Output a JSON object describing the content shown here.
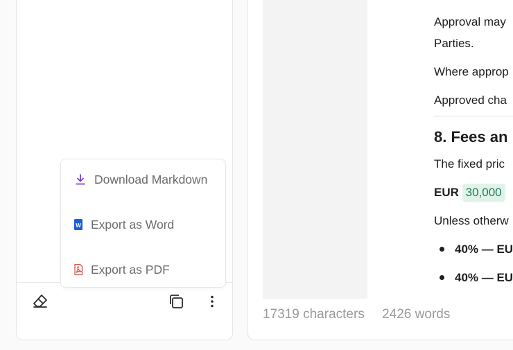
{
  "export_menu": {
    "items": [
      {
        "label": "Download Markdown",
        "icon": "download-icon"
      },
      {
        "label": "Export as Word",
        "icon": "word-icon"
      },
      {
        "label": "Export as PDF",
        "icon": "pdf-icon"
      }
    ]
  },
  "toolbar": {
    "clear_icon": "eraser-icon",
    "copy_icon": "copy-icon",
    "more_icon": "more-vertical-icon"
  },
  "document": {
    "lines": [
      "Approval may",
      "Parties.",
      "Where approp",
      "Approved cha"
    ],
    "heading": "8. Fees an",
    "price_line": "The fixed pric",
    "amount_currency": "EUR",
    "amount_value": "30,000",
    "unless_line": "Unless otherw",
    "bullets": [
      "40% — EU",
      "40% — EU"
    ]
  },
  "status": {
    "characters": "17319 characters",
    "words": "2426 words"
  },
  "colors": {
    "download_icon": "#7b3fd1",
    "word_icon": "#1e5fd9",
    "pdf_icon": "#d9534f",
    "chip_bg": "#dff3ea",
    "chip_text": "#237a55"
  }
}
